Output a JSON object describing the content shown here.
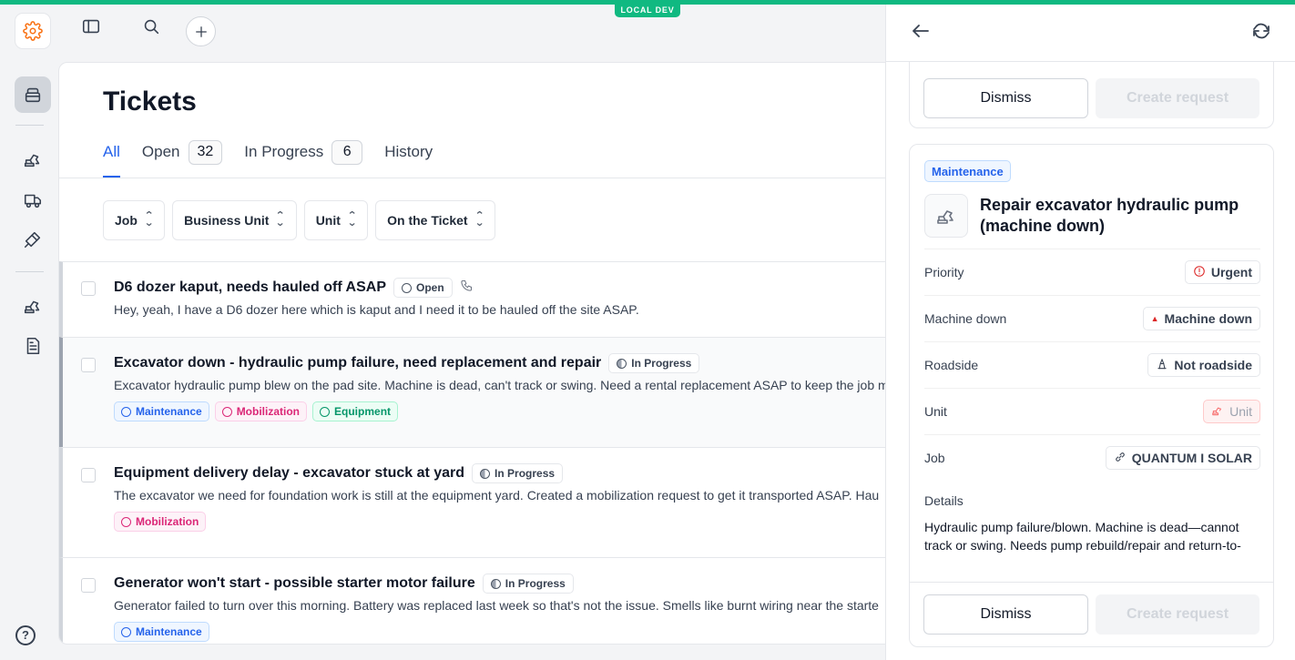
{
  "env_badge": "LOCAL DEV",
  "page": {
    "title": "Tickets"
  },
  "tabs": [
    {
      "label": "All",
      "active": true
    },
    {
      "label": "Open",
      "count": "32"
    },
    {
      "label": "In Progress",
      "count": "6"
    },
    {
      "label": "History"
    }
  ],
  "filters": [
    "Job",
    "Business Unit",
    "Unit",
    "On the Ticket"
  ],
  "tickets": [
    {
      "title": "D6 dozer kaput, needs hauled off ASAP",
      "status": "Open",
      "description": "Hey, yeah, I have a D6 dozer here which is kaput and I need it to be hauled off the site ASAP.",
      "tags": []
    },
    {
      "title": "Excavator down - hydraulic pump failure, need replacement and repair",
      "status": "In Progress",
      "description": "Excavator hydraulic pump blew on the pad site. Machine is dead, can't track or swing. Need a rental replacement ASAP to keep the job m",
      "tags": [
        "Maintenance",
        "Mobilization",
        "Equipment"
      ]
    },
    {
      "title": "Equipment delivery delay - excavator stuck at yard",
      "status": "In Progress",
      "description": "The excavator we need for foundation work is still at the equipment yard. Created a mobilization request to get it transported ASAP. Hau",
      "tags": [
        "Mobilization"
      ]
    },
    {
      "title": "Generator won't start - possible starter motor failure",
      "status": "In Progress",
      "description": "Generator failed to turn over this morning. Battery was replaced last week so that's not the issue. Smells like burnt wiring near the starte",
      "tags": [
        "Maintenance"
      ]
    }
  ],
  "panel": {
    "top_card": {
      "dismiss": "Dismiss",
      "create": "Create request"
    },
    "request": {
      "category": "Maintenance",
      "title": "Repair excavator hydraulic pump (machine down)",
      "properties": [
        {
          "label": "Priority",
          "value": "Urgent",
          "icon": "alert-circle-icon"
        },
        {
          "label": "Machine down",
          "value": "Machine down",
          "icon": "machine-down-icon"
        },
        {
          "label": "Roadside",
          "value": "Not roadside",
          "icon": "roadside-icon"
        },
        {
          "label": "Unit",
          "value": "Unit",
          "icon": "excavator-icon"
        },
        {
          "label": "Job",
          "value": "QUANTUM I SOLAR",
          "icon": "link-icon"
        }
      ],
      "details_label": "Details",
      "details": "Hydraulic pump failure/blown. Machine is dead—cannot track or swing. Needs pump rebuild/repair and return-to-",
      "dismiss": "Dismiss",
      "create": "Create request"
    }
  },
  "colors": {
    "accent": "#10b981",
    "link": "#2563eb",
    "urgent": "#dc2626"
  }
}
